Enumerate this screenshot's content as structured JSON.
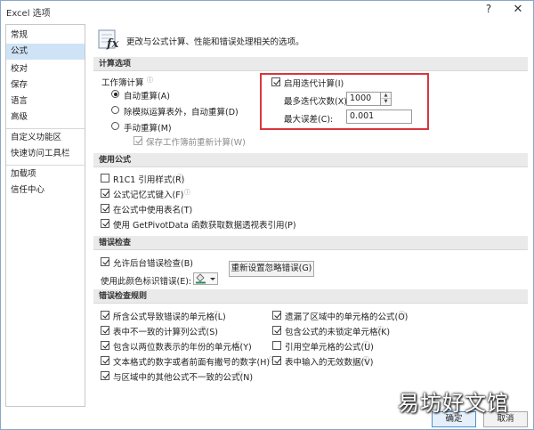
{
  "window": {
    "title": "Excel 选项",
    "help": "?",
    "close": "✕"
  },
  "sidebar": {
    "items": [
      "常规",
      "公式",
      "校对",
      "保存",
      "语言",
      "高级",
      "自定义功能区",
      "快速访问工具栏",
      "加载项",
      "信任中心"
    ],
    "active_index": 1
  },
  "header": {
    "icon": "fx-icon",
    "text": "更改与公式计算、性能和错误处理相关的选项。"
  },
  "calc": {
    "section_title": "计算选项",
    "workbook_label": "工作簿计算",
    "radios": [
      "自动重算(A)",
      "除模拟运算表外，自动重算(D)",
      "手动重算(M)"
    ],
    "selected_radio": 0,
    "save_before_recalc": {
      "label": "保存工作簿前重新计算(W)",
      "checked": true,
      "disabled": true
    },
    "iterative": {
      "label": "启用迭代计算(I)",
      "checked": true
    },
    "max_iterations": {
      "label": "最多迭代次数(X):",
      "value": "1000"
    },
    "max_change": {
      "label": "最大误差(C):",
      "value": "0.001"
    }
  },
  "formulas": {
    "section_title": "使用公式",
    "items": [
      {
        "label": "R1C1 引用样式(R)",
        "checked": false,
        "info": true
      },
      {
        "label": "公式记忆式键入(F)",
        "checked": true,
        "info": true
      },
      {
        "label": "在公式中使用表名(T)",
        "checked": true,
        "info": false
      },
      {
        "label": "使用 GetPivotData 函数获取数据透视表引用(P)",
        "checked": true,
        "info": false
      }
    ]
  },
  "error_check": {
    "section_title": "错误检查",
    "background": {
      "label": "允许后台错误检查(B)",
      "checked": true
    },
    "color_label": "使用此颜色标识错误(E):",
    "reset_button": "重新设置忽略错误(G)",
    "indicator_color": "#2e8b57"
  },
  "rules": {
    "section_title": "错误检查规则",
    "left": [
      {
        "label": "所含公式导致错误的单元格(L)",
        "checked": true
      },
      {
        "label": "表中不一致的计算列公式(S)",
        "checked": true
      },
      {
        "label": "包含以两位数表示的年份的单元格(Y)",
        "checked": true
      },
      {
        "label": "文本格式的数字或者前面有撇号的数字(H)",
        "checked": true
      },
      {
        "label": "与区域中的其他公式不一致的公式(N)",
        "checked": true
      }
    ],
    "right": [
      {
        "label": "遗漏了区域中的单元格的公式(O)",
        "checked": true
      },
      {
        "label": "包含公式的未锁定单元格(K)",
        "checked": true
      },
      {
        "label": "引用空单元格的公式(U)",
        "checked": false
      },
      {
        "label": "表中输入的无效数据(V)",
        "checked": true
      }
    ]
  },
  "footer": {
    "ok": "确定",
    "cancel": "取消"
  },
  "watermark": "易坊好文馆",
  "colors": {
    "highlight_border": "#d9363e",
    "sidebar_active": "#cfe3f6",
    "section_bg": "#eaeaea"
  }
}
